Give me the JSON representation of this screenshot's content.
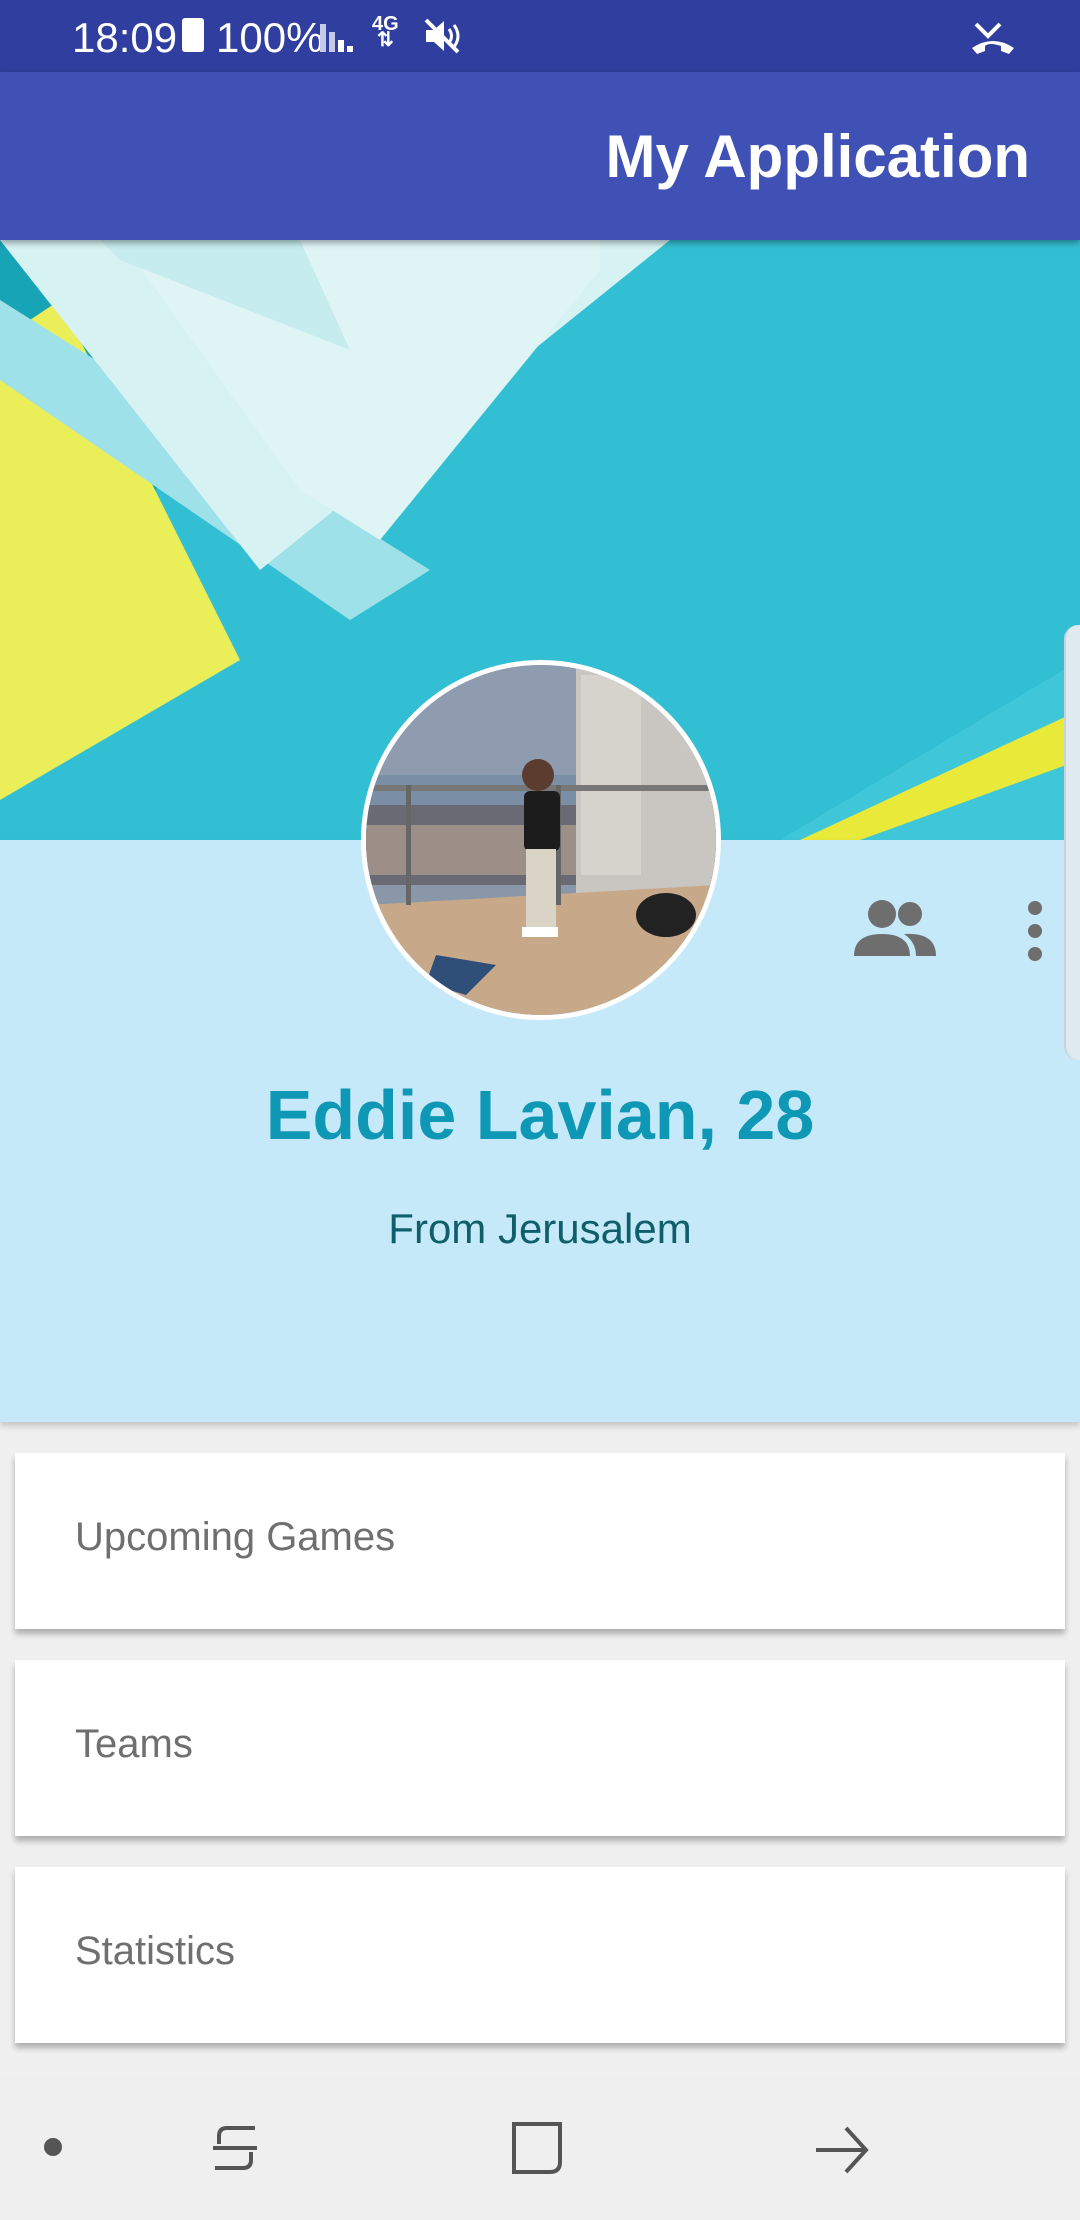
{
  "status_bar": {
    "time": "18:09",
    "battery": "100%",
    "network": "4G",
    "icons": [
      "battery-icon",
      "signal-icon",
      "mute-icon",
      "missed-call-icon"
    ]
  },
  "app_bar": {
    "title": "My Application"
  },
  "profile": {
    "name": "Eddie Lavian, 28",
    "location": "From  Jerusalem",
    "actions": [
      "friends-icon",
      "more-vert-icon"
    ]
  },
  "menu": {
    "items": [
      {
        "label": "Upcoming Games"
      },
      {
        "label": "Teams"
      },
      {
        "label": "Statistics"
      }
    ]
  },
  "nav_bar": {
    "icons": [
      "dot-icon",
      "recents-icon",
      "home-icon",
      "back-icon"
    ]
  },
  "colors": {
    "status_bar": "#303f9f",
    "app_bar": "#3f51b5",
    "profile_bg": "#c5e9f9",
    "name": "#0f98b5",
    "location": "#0f5f6a"
  }
}
